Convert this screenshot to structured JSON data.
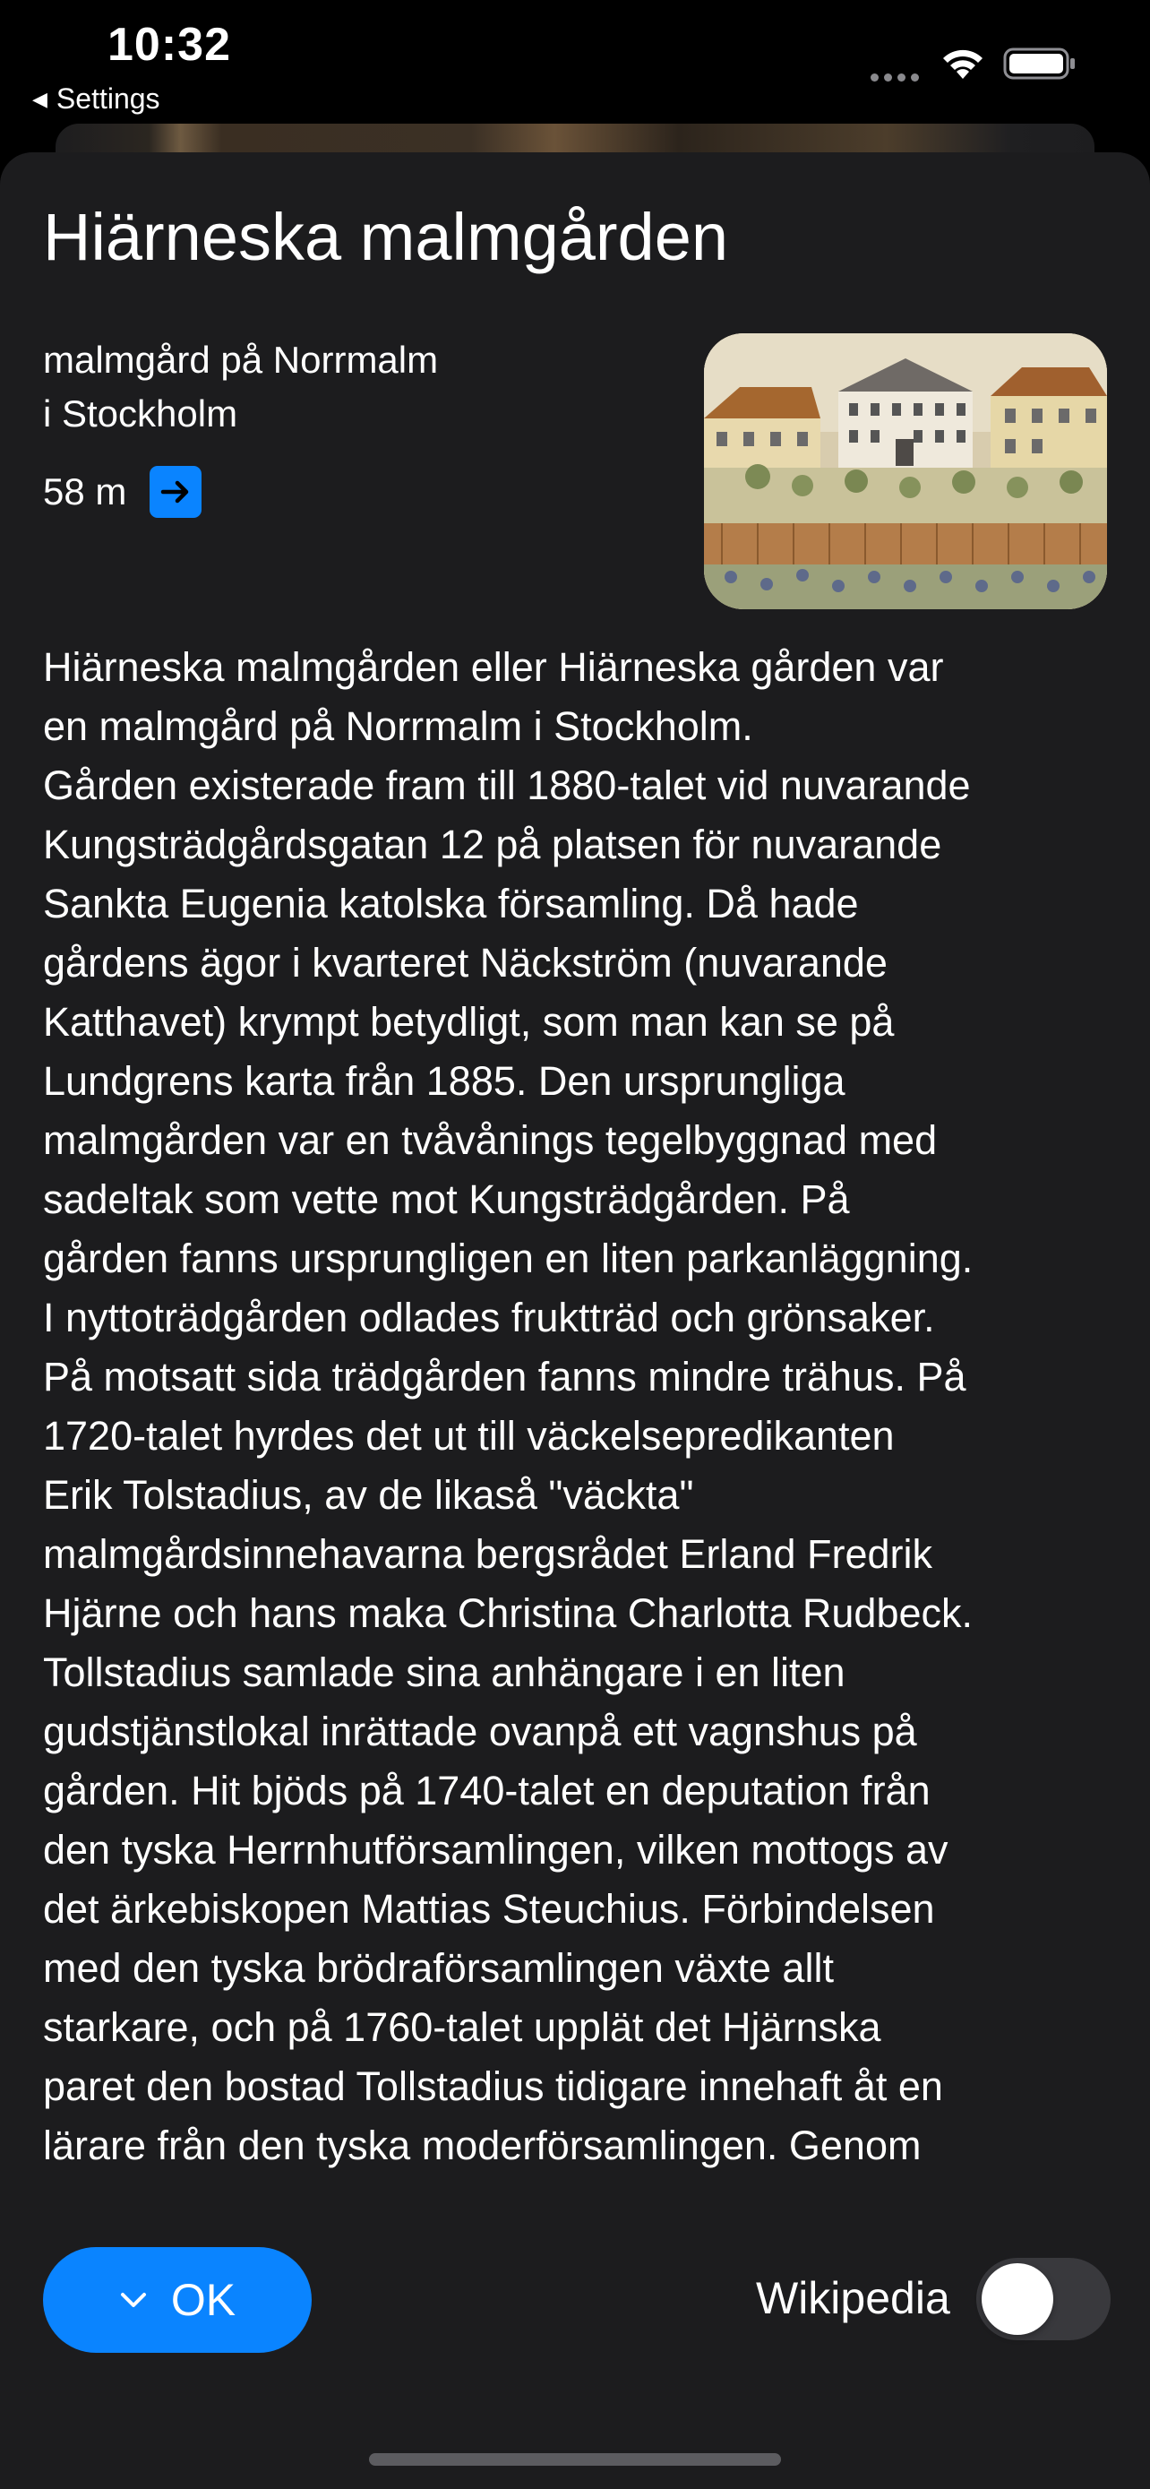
{
  "status_bar": {
    "time": "10:32",
    "back_app": "Settings"
  },
  "place": {
    "title": "Hiärneska malmgården",
    "subtitle_lines": [
      "malmgård på Norrmalm",
      "i Stockholm"
    ],
    "distance": "58 m",
    "thumbnail_icon": "historic-painting-image"
  },
  "article": {
    "lines": [
      "Hiärneska malmgården eller  Hiärneska gården var",
      "en malmgård på Norrmalm i Stockholm.",
      "Gården existerade fram till 1880-talet vid nuvarande",
      "Kungsträdgårdsgatan 12 på platsen för nuvarande",
      "Sankta Eugenia katolska församling. Då hade",
      "gårdens ägor i kvarteret Näckström (nuvarande",
      "Katthavet) krympt betydligt, som man kan se på",
      "Lundgrens karta från 1885. Den ursprungliga",
      "malmgården var en tvåvånings tegelbyggnad med",
      "sadeltak som vette mot Kungsträdgården. På",
      "gården fanns ursprungligen en liten parkanläggning.",
      "I nyttoträdgården odlades fruktträd och grönsaker.",
      "På motsatt sida trädgården fanns mindre trähus. På",
      "1720-talet hyrdes det ut till väckelsepredikanten",
      "Erik Tolstadius, av de likaså \"väckta\"",
      "malmgårdsinnehavarna bergsrådet Erland Fredrik",
      "Hjärne och hans maka Christina Charlotta Rudbeck.",
      "Tollstadius samlade sina anhängare i en liten",
      "gudstjänstlokal inrättade ovanpå ett vagnshus på",
      "gården. Hit bjöds på 1740-talet en deputation från",
      "den tyska Herrnhutförsamlingen, vilken mottogs av",
      "det ärkebiskopen Mattias Steuchius. Förbindelsen",
      "med den tyska brödraförsamlingen växte allt",
      "starkare, och på 1760-talet upplät det Hjärnska",
      "paret den bostad Tollstadius tidigare innehaft åt en",
      "lärare från den tyska moderförsamlingen. Genom"
    ]
  },
  "footer": {
    "ok_label": "OK",
    "wikipedia_label": "Wikipedia",
    "wikipedia_toggle_on": false
  },
  "colors": {
    "accent": "#0a84ff",
    "sheet_background": "#1c1c1e",
    "toggle_off": "#39393d"
  }
}
